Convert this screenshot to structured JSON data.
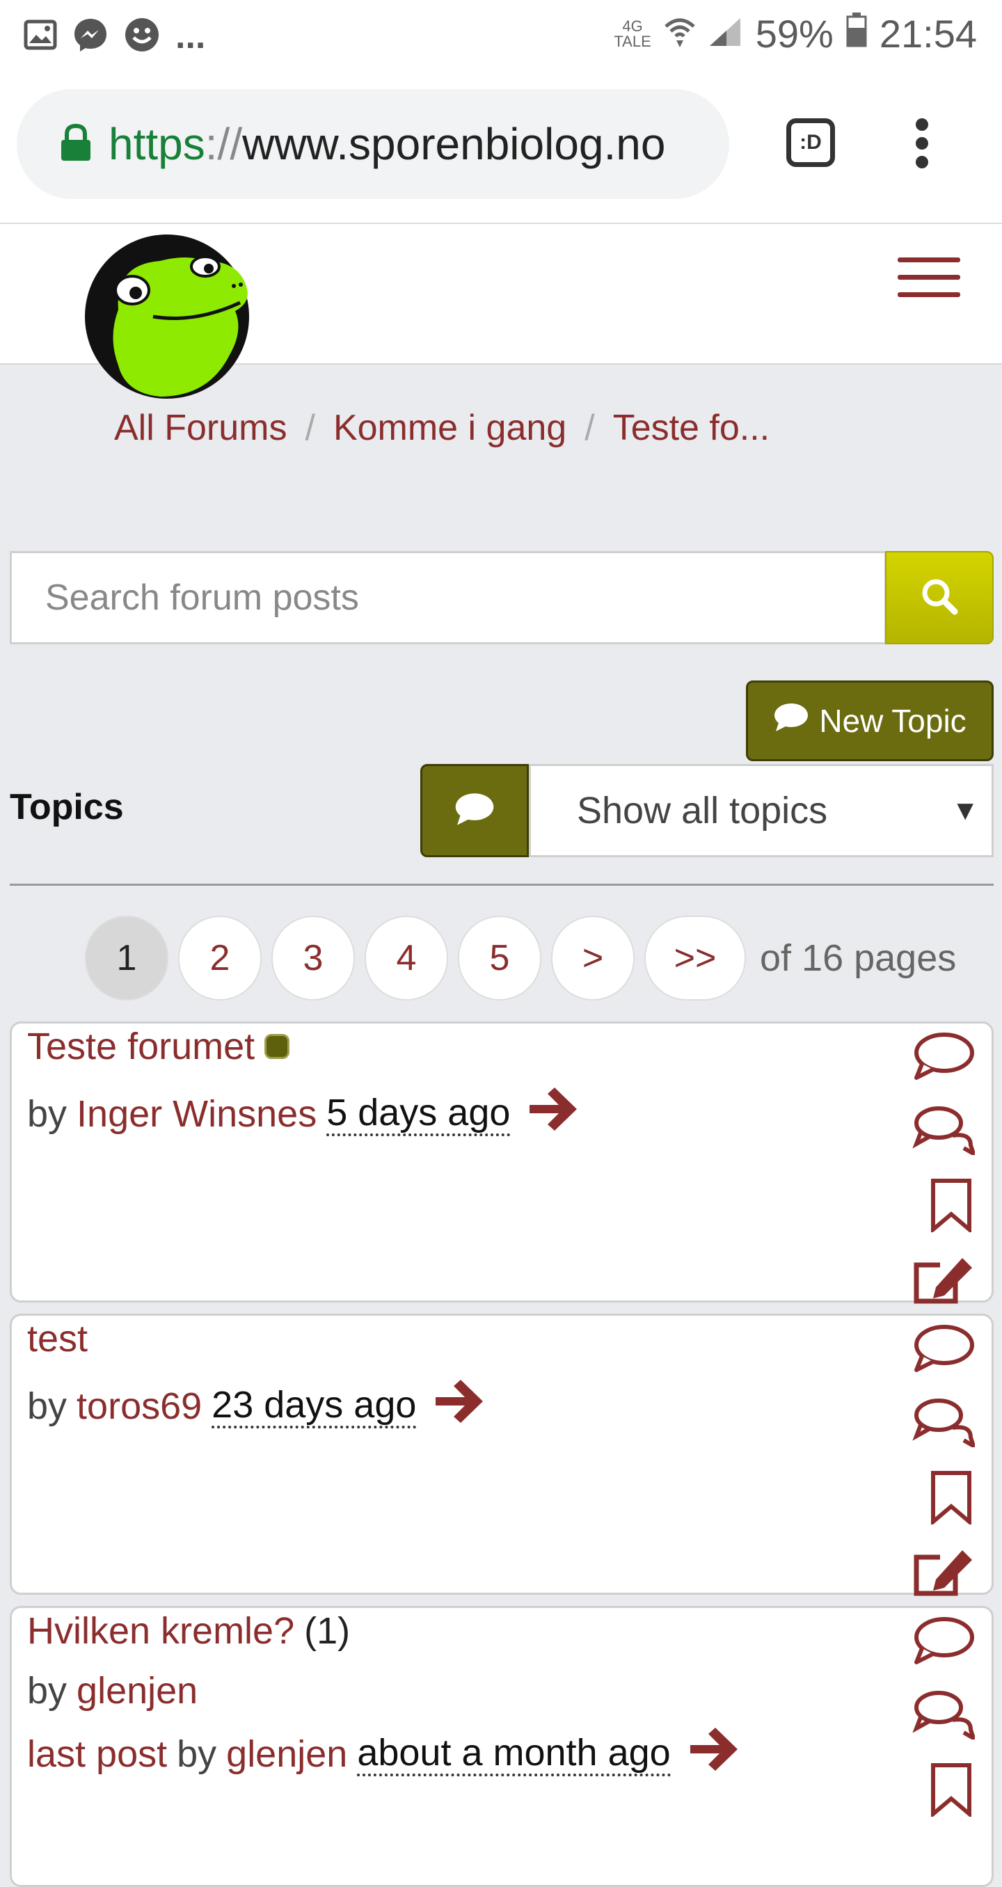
{
  "status_bar": {
    "notification_overflow": "...",
    "network_top": "4G",
    "network_bottom": "TALE",
    "battery": "59%",
    "time": "21:54"
  },
  "browser": {
    "url_scheme": "https",
    "url_separator": "://",
    "url_host": "www.sporenbiolog.no",
    "tab_switcher_label": ":D"
  },
  "breadcrumb": [
    "All Forums",
    "Komme i gang",
    "Teste fo..."
  ],
  "search": {
    "placeholder": "Search forum posts"
  },
  "new_topic_label": "New Topic",
  "topics_heading": "Topics",
  "filter": {
    "selected": "Show all topics"
  },
  "pagination": {
    "pages": [
      "1",
      "2",
      "3",
      "4",
      "5",
      ">",
      ">>"
    ],
    "current": "1",
    "info": "of 16 pages"
  },
  "topics": [
    {
      "title": "Teste forumet",
      "by": "by",
      "author": "Inger Winsnes",
      "time": "5 days ago"
    },
    {
      "title": "test",
      "by": "by",
      "author": "toros69",
      "time": "23 days ago"
    },
    {
      "title": "Hvilken kremle?",
      "count": "(1)",
      "by": "by",
      "author": "glenjen",
      "last_post_label": "last post",
      "last_post_by": "by",
      "last_post_author": "glenjen",
      "time": "about a month ago"
    }
  ],
  "colors": {
    "accent": "#8b2d2d",
    "olive_button": "#6b6b10",
    "search_button": "#c8c800"
  }
}
